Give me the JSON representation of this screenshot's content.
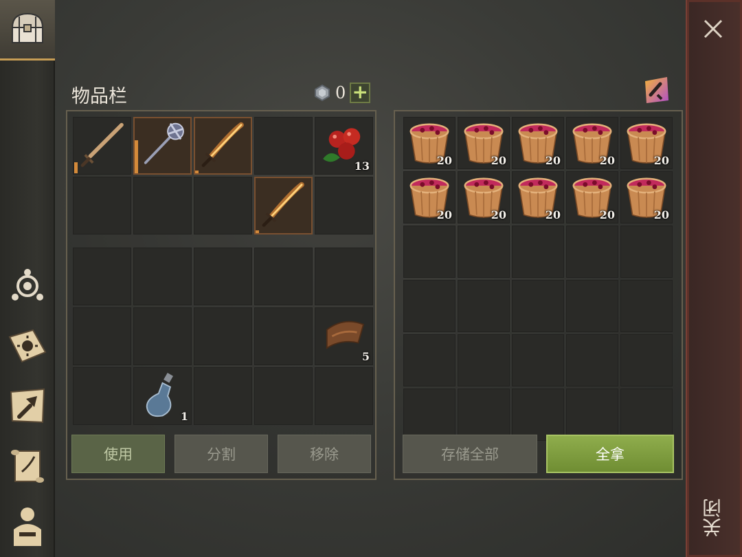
{
  "inventory": {
    "title": "物品栏",
    "currency_value": "0",
    "top_slots": [
      {
        "item": "wooden-sword",
        "qty": "",
        "dur": 0.2
      },
      {
        "item": "mace",
        "qty": "",
        "dur": 0.6
      },
      {
        "item": "flame-sword",
        "qty": "",
        "dur": 0.05
      },
      {
        "item": "",
        "qty": ""
      },
      {
        "item": "berries",
        "qty": "13"
      },
      {
        "item": "",
        "qty": ""
      },
      {
        "item": "",
        "qty": ""
      },
      {
        "item": "",
        "qty": ""
      },
      {
        "item": "flame-sword",
        "qty": "",
        "dur": 0.05
      },
      {
        "item": "",
        "qty": ""
      }
    ],
    "bottom_slots": [
      {
        "item": "",
        "qty": ""
      },
      {
        "item": "",
        "qty": ""
      },
      {
        "item": "",
        "qty": ""
      },
      {
        "item": "",
        "qty": ""
      },
      {
        "item": "",
        "qty": ""
      },
      {
        "item": "",
        "qty": ""
      },
      {
        "item": "",
        "qty": ""
      },
      {
        "item": "",
        "qty": ""
      },
      {
        "item": "",
        "qty": ""
      },
      {
        "item": "leather",
        "qty": "5"
      },
      {
        "item": "",
        "qty": ""
      },
      {
        "item": "bottle",
        "qty": "1"
      },
      {
        "item": "",
        "qty": ""
      },
      {
        "item": "",
        "qty": ""
      },
      {
        "item": "",
        "qty": ""
      }
    ],
    "buttons": {
      "use": "使用",
      "split": "分割",
      "remove": "移除"
    }
  },
  "container": {
    "slots": [
      {
        "item": "berry-bucket",
        "qty": "20"
      },
      {
        "item": "berry-bucket",
        "qty": "20"
      },
      {
        "item": "berry-bucket",
        "qty": "20"
      },
      {
        "item": "berry-bucket",
        "qty": "20"
      },
      {
        "item": "berry-bucket",
        "qty": "20"
      },
      {
        "item": "berry-bucket",
        "qty": "20"
      },
      {
        "item": "berry-bucket",
        "qty": "20"
      },
      {
        "item": "berry-bucket",
        "qty": "20"
      },
      {
        "item": "berry-bucket",
        "qty": "20"
      },
      {
        "item": "berry-bucket",
        "qty": "20"
      },
      {
        "item": "",
        "qty": ""
      },
      {
        "item": "",
        "qty": ""
      },
      {
        "item": "",
        "qty": ""
      },
      {
        "item": "",
        "qty": ""
      },
      {
        "item": "",
        "qty": ""
      },
      {
        "item": "",
        "qty": ""
      },
      {
        "item": "",
        "qty": ""
      },
      {
        "item": "",
        "qty": ""
      },
      {
        "item": "",
        "qty": ""
      },
      {
        "item": "",
        "qty": ""
      },
      {
        "item": "",
        "qty": ""
      },
      {
        "item": "",
        "qty": ""
      },
      {
        "item": "",
        "qty": ""
      },
      {
        "item": "",
        "qty": ""
      },
      {
        "item": "",
        "qty": ""
      },
      {
        "item": "",
        "qty": ""
      },
      {
        "item": "",
        "qty": ""
      },
      {
        "item": "",
        "qty": ""
      },
      {
        "item": "",
        "qty": ""
      },
      {
        "item": "",
        "qty": ""
      }
    ],
    "buttons": {
      "store_all": "存储全部",
      "take_all": "全拿"
    }
  },
  "close": {
    "label": "关闭"
  },
  "sidebar": {
    "icons": [
      "chest-icon",
      "skills-icon",
      "sun-journal-icon",
      "crafting-icon",
      "quest-scroll-icon",
      "character-icon"
    ]
  },
  "colors": {
    "accent_green": "#8fad4c",
    "close_red": "#7a3f35",
    "durability_orange": "#d48a3a"
  }
}
